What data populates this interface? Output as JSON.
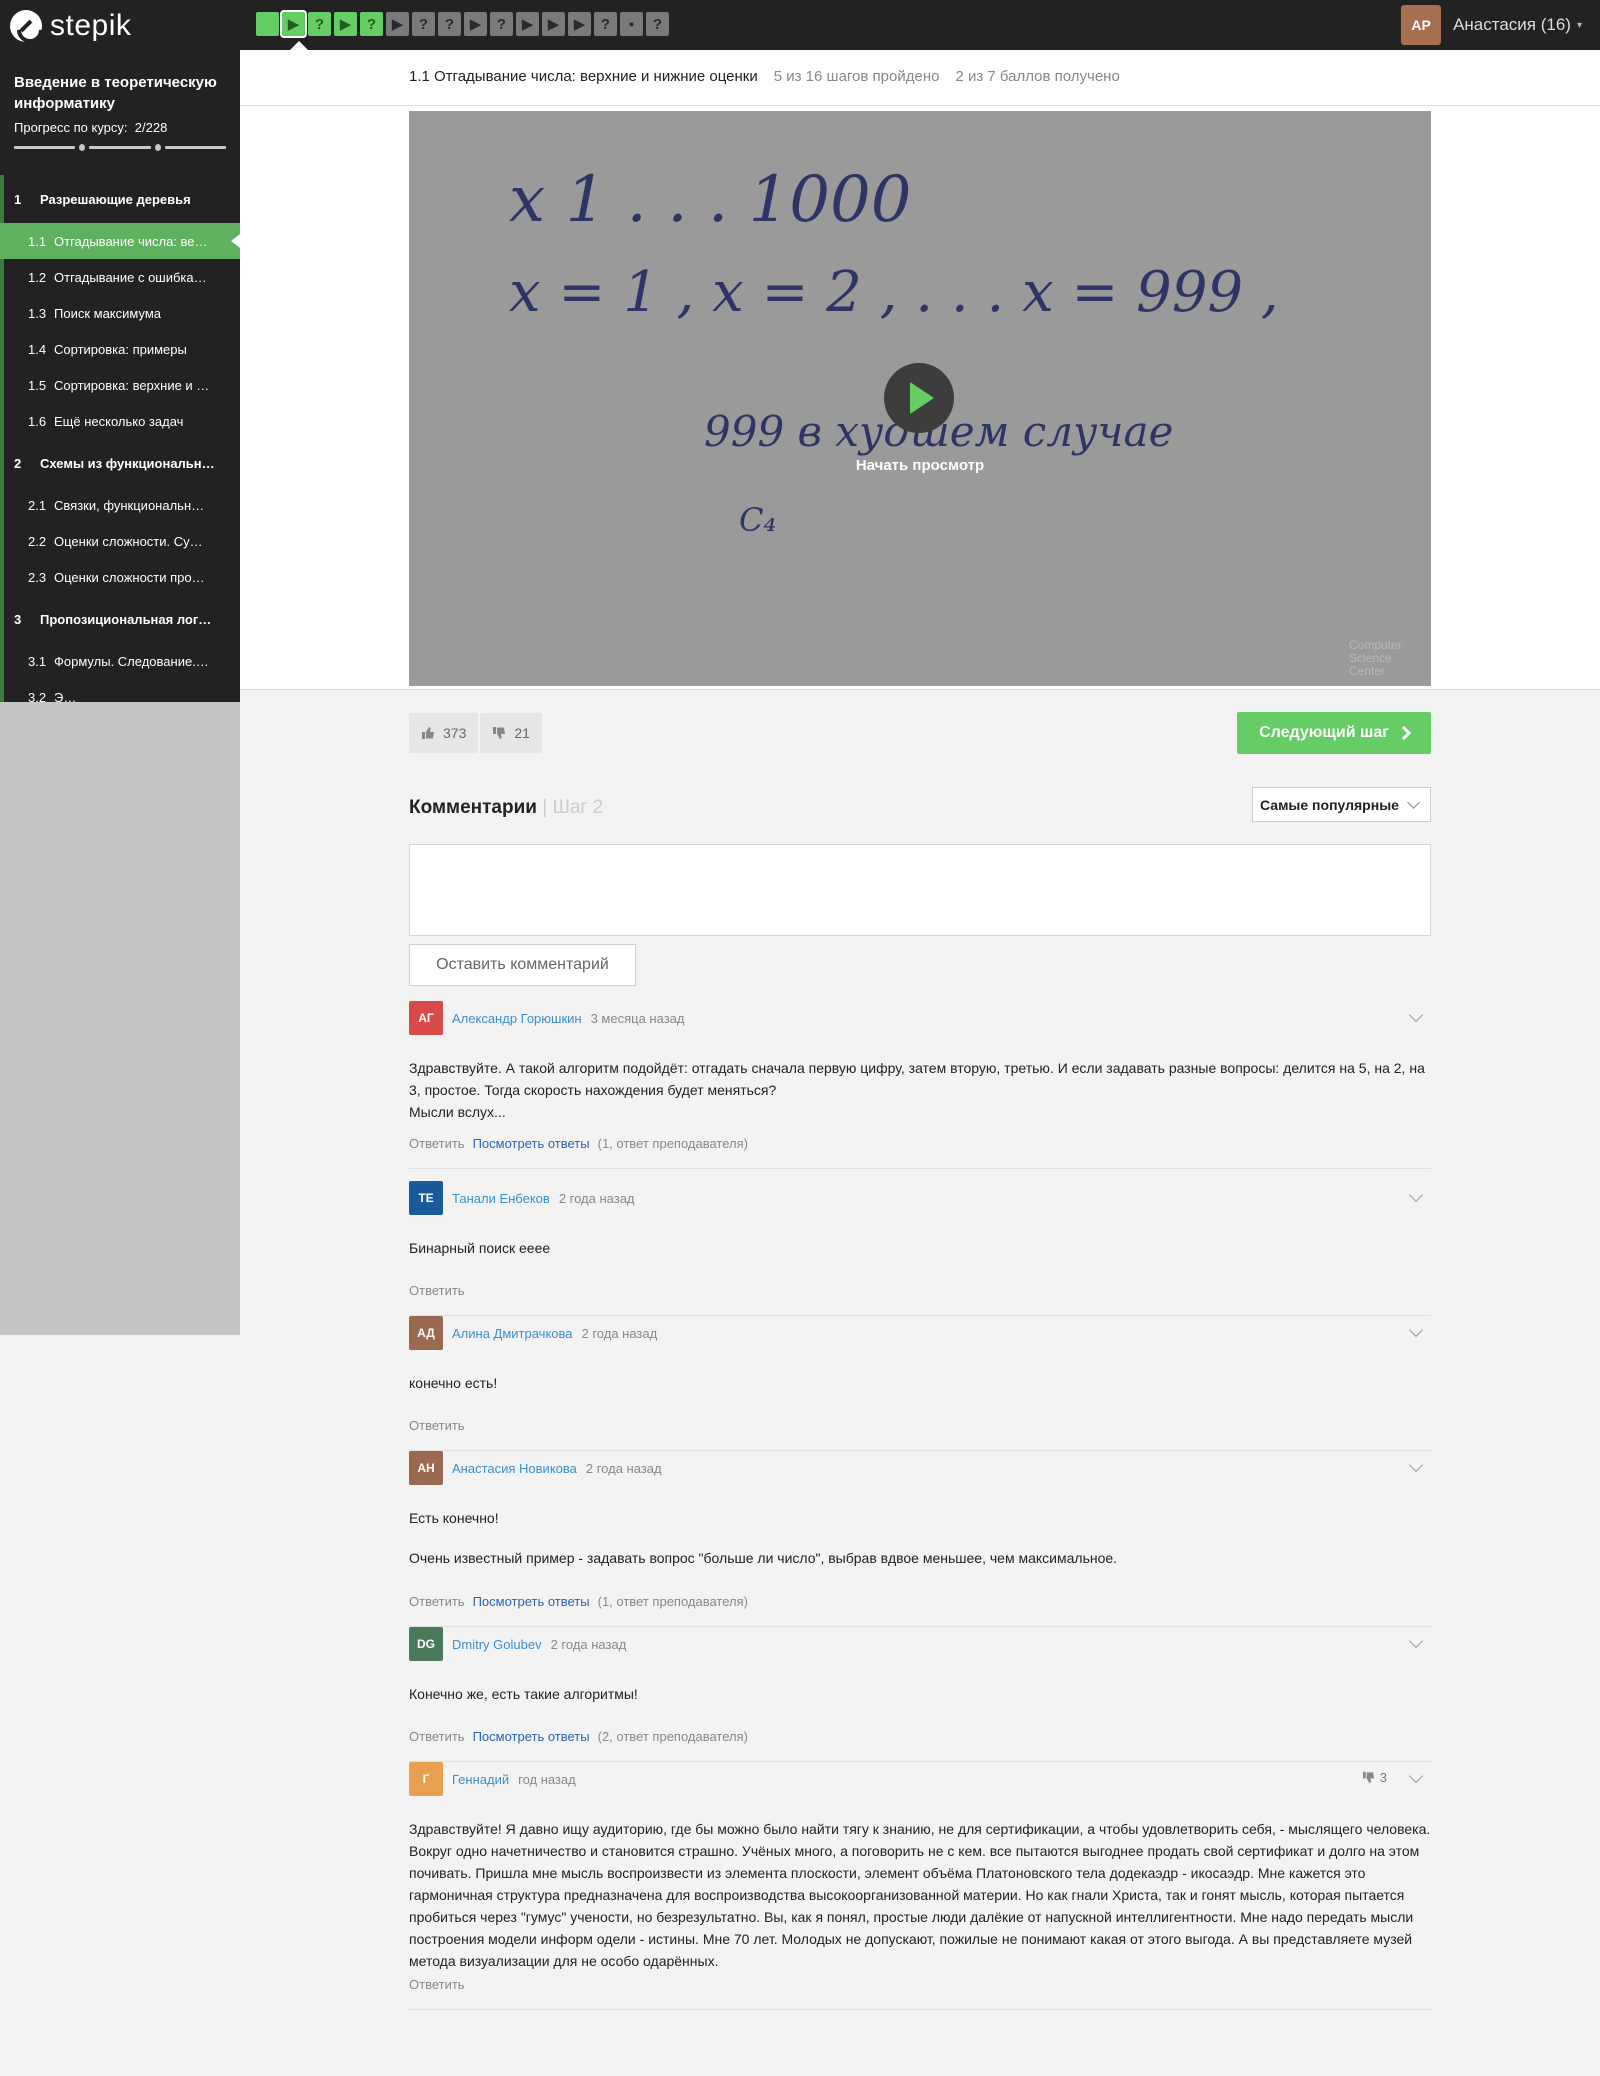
{
  "brand": {
    "name": "stepik"
  },
  "steps": [
    {
      "kind": "done",
      "glyph": ""
    },
    {
      "kind": "current",
      "glyph": "▶"
    },
    {
      "kind": "done",
      "glyph": "?"
    },
    {
      "kind": "done",
      "glyph": "▶"
    },
    {
      "kind": "done",
      "glyph": "?"
    },
    {
      "kind": "todo",
      "glyph": "▶"
    },
    {
      "kind": "todo",
      "glyph": "?"
    },
    {
      "kind": "todo",
      "glyph": "?"
    },
    {
      "kind": "todo",
      "glyph": "▶"
    },
    {
      "kind": "todo",
      "glyph": "?"
    },
    {
      "kind": "todo",
      "glyph": "▶"
    },
    {
      "kind": "todo",
      "glyph": "▶"
    },
    {
      "kind": "todo",
      "glyph": "▶"
    },
    {
      "kind": "todo",
      "glyph": "?"
    },
    {
      "kind": "todo",
      "glyph": "▪"
    },
    {
      "kind": "todo",
      "glyph": "?"
    }
  ],
  "user": {
    "initials": "AP",
    "name": "Анастасия (16)"
  },
  "sidebar": {
    "course_title": "Введение в теоретическую информатику",
    "progress_label": "Прогресс по курсу:",
    "progress_value": "2/228",
    "progress_fraction": 0.0088,
    "items": [
      {
        "type": "section",
        "num": "1",
        "label": "Разрешающие деревья"
      },
      {
        "type": "lesson",
        "num": "1.1",
        "label": "Отгадывание числа: ве…",
        "active": true
      },
      {
        "type": "lesson",
        "num": "1.2",
        "label": "Отгадывание с ошибка…"
      },
      {
        "type": "lesson",
        "num": "1.3",
        "label": "Поиск максимума"
      },
      {
        "type": "lesson",
        "num": "1.4",
        "label": "Сортировка: примеры"
      },
      {
        "type": "lesson",
        "num": "1.5",
        "label": "Сортировка: верхние и …"
      },
      {
        "type": "lesson",
        "num": "1.6",
        "label": "Ещё несколько задач"
      },
      {
        "type": "section",
        "num": "2",
        "label": "Схемы из функциональн…"
      },
      {
        "type": "lesson",
        "num": "2.1",
        "label": "Связки, функциональн…"
      },
      {
        "type": "lesson",
        "num": "2.2",
        "label": "Оценки сложности. Су…"
      },
      {
        "type": "lesson",
        "num": "2.3",
        "label": "Оценки сложности про…"
      },
      {
        "type": "section",
        "num": "3",
        "label": "Пропозициональная лог…"
      },
      {
        "type": "lesson",
        "num": "3.1",
        "label": "Формулы. Следование.…"
      },
      {
        "type": "lesson",
        "num": "3.2",
        "label": "Э…"
      }
    ]
  },
  "lesson": {
    "title": "1.1 Отгадывание числа: верхние и нижние оценки",
    "steps_passed": "5 из 16 шагов пройдено",
    "points": "2 из 7 баллов  получено"
  },
  "video": {
    "handwriting_lines": [
      "x      1 . . . 1000",
      "x = 1 , x = 2 , . . .  x = 999 ,",
      "999   в  худшем  случае",
      "C₄"
    ],
    "play_label": "Начать просмотр",
    "watermark": "Computer Science Center"
  },
  "reactions": {
    "likes": "373",
    "dislikes": "21"
  },
  "next_button": "Следующий шаг",
  "comments_section": {
    "title": "Комментарии",
    "step_ref": "| Шаг 2",
    "sort_selected": "Самые популярные",
    "leave_button": "Оставить комментарий"
  },
  "comments": [
    {
      "initials": "АГ",
      "color": "#d94a4a",
      "author": "Александр Горюшкин",
      "time": "3 месяца назад",
      "body": [
        "Здравствуйте. А такой алгоритм подойдёт: отгадать сначала первую цифру, затем вторую, третью. И если задавать разные вопросы: делится на 5, на 2, на 3, простое. Тогда скорость нахождения будет меняться?",
        "Мысли вслух..."
      ],
      "reply": "Ответить",
      "view": "Посмотреть ответы",
      "view_note": "(1, ответ преподавателя)"
    },
    {
      "initials": "ТЕ",
      "color": "#1a5a9a",
      "author": "Танали Енбеков",
      "time": "2 года назад",
      "body": [
        "Бинарный поиск ееее"
      ],
      "reply": "Ответить"
    },
    {
      "initials": "АД",
      "color": "#9a6a50",
      "author": "Алина Дмитрачкова",
      "time": "2 года назад",
      "body": [
        "конечно есть!"
      ],
      "reply": "Ответить"
    },
    {
      "initials": "АН",
      "color": "#9a6a50",
      "author": "Анастасия Новикова",
      "time": "2 года назад",
      "body": [
        "Есть конечно!",
        "",
        "Очень известный пример - задавать вопрос \"больше ли число\", выбрав вдвое меньшее, чем максимальное."
      ],
      "reply": "Ответить",
      "view": "Посмотреть ответы",
      "view_note": "(1, ответ преподавателя)"
    },
    {
      "initials": "DG",
      "color": "#4a7a5a",
      "author": "Dmitry Golubev",
      "time": "2 года назад",
      "body": [
        "Конечно же, есть такие алгоритмы!"
      ],
      "reply": "Ответить",
      "view": "Посмотреть ответы",
      "view_note": "(2, ответ преподавателя)"
    },
    {
      "initials": "Г",
      "color": "#e8a050",
      "author": "Геннадий",
      "time": "год назад",
      "dislikes": "3",
      "body": [
        "Здравствуйте! Я давно ищу аудиторию, где  бы можно было найти тягу к знанию, не для  сертификации, а чтобы удовлетворить себя, - мыслящего человека.  Вокруг одно начетничество и становится  страшно. Учёных много, а поговорить не с кем. все  пытаются выгоднее продать свой  сертификат и долго  на этом почивать. Пришла  мне мысль воспроизвести из элемента  плоскости, элемент объёма Платоновского тела додекаэдр - икосаэдр. Мне кажется это гармоничная  структура предназначена для  воспроизводства высокоорганизованной  материи.  Но как гнали Христа, так и гонят мысль, которая  пытается пробиться через  \"гумус\" учености, но безрезультатно. Вы, как я понял, простые люди далёкие от напускной  интеллигентности. Мне надо передать мысли  построения  модели информ одели - истины. Мне 70 лет. Молодых не допускают, пожилые не понимают какая от этого выгода. А вы представляете музей  метода визуализации для не особо одарённых."
      ],
      "reply": "Ответить"
    }
  ]
}
